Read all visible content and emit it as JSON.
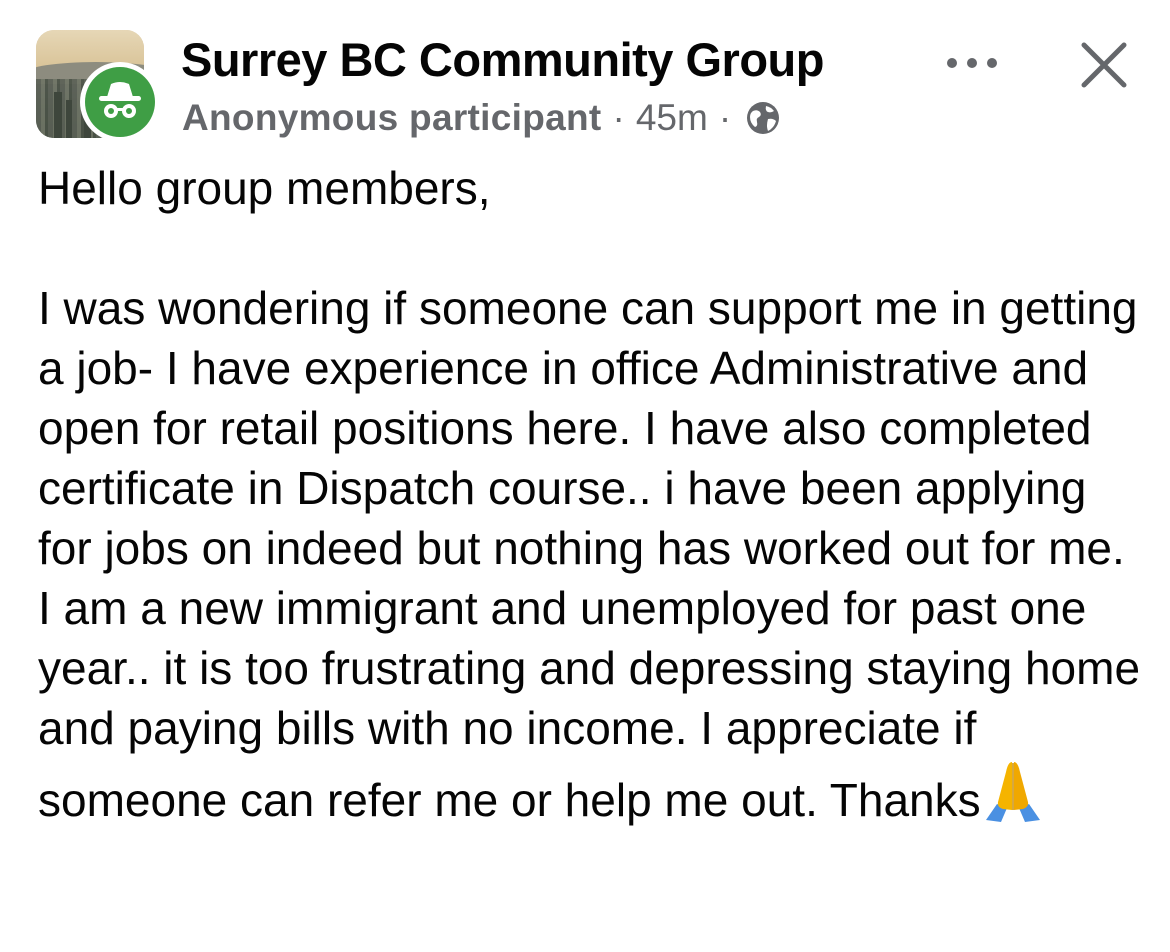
{
  "post": {
    "group_name": "Surrey BC Community Group",
    "author": "Anonymous participant",
    "separator": "·",
    "time": "45m",
    "audience_icon": "globe-icon",
    "more_icon": "more-horizontal-icon",
    "close_icon": "close-icon",
    "avatar_icon": "anonymous-incognito-icon",
    "body_greeting": "Hello group members,",
    "body_main": "I was wondering if someone can support me in getting a job- I have experience in office Administrative and open for retail positions here. I have also completed certificate in Dispatch course.. i have been applying for jobs on indeed but nothing has worked out for me. I am a new immigrant and unemployed for past one year.. it is too frustrating and depressing staying home and paying bills with no income. I appreciate if someone can refer me or help me out. Thanks",
    "body_emoji": "folded-hands-emoji"
  },
  "colors": {
    "text_primary": "#050505",
    "text_secondary": "#65676b",
    "anon_badge_green": "#3f9e45",
    "emoji_blue": "#4a90e2",
    "emoji_skin": "#f5b400"
  }
}
